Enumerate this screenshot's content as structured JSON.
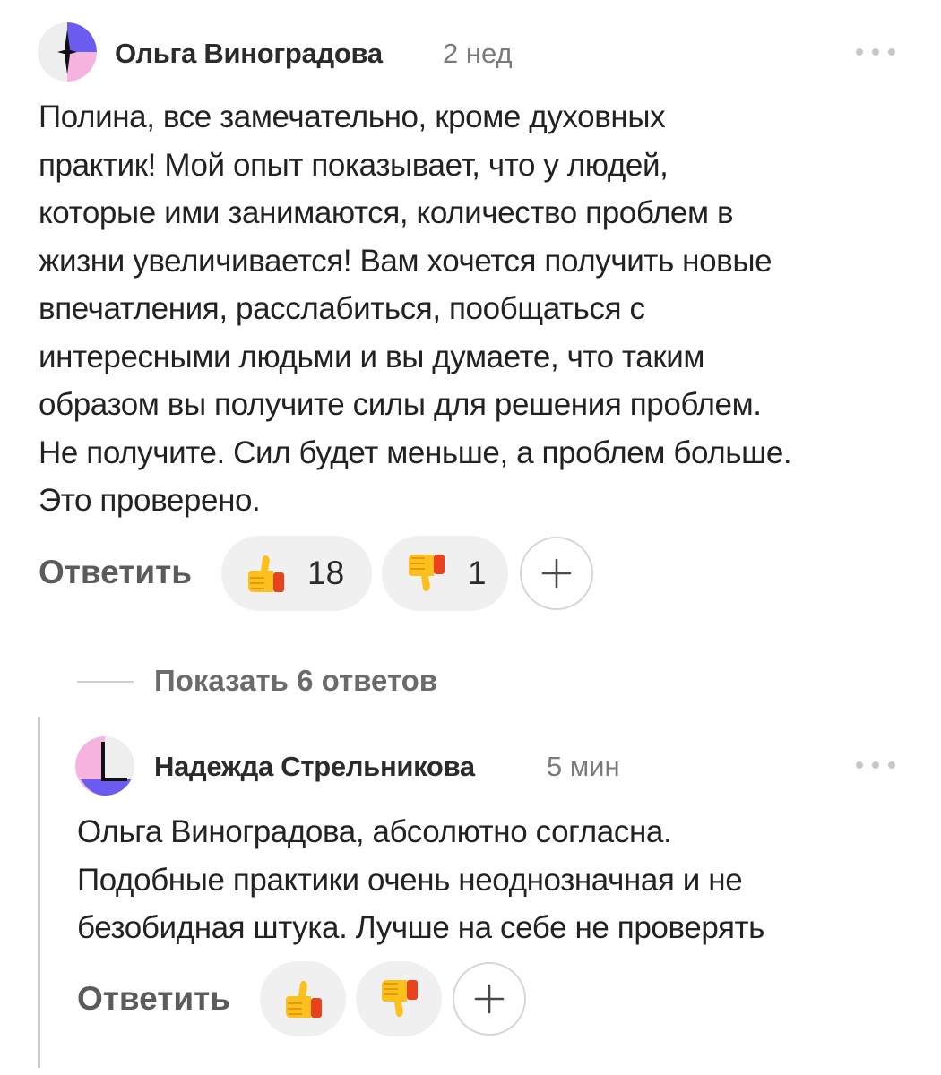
{
  "comment1": {
    "author": "Ольга Виноградова",
    "time": "2 нед",
    "text_lines": [
      "Полина, все замечательно, кроме духовных",
      "практик! Мой опыт показывает, что у людей,",
      "которые ими занимаются, количество проблем в",
      "жизни увеличивается! Вам хочется получить новые",
      "впечатления, расслабиться, пообщаться с",
      "интересными людьми и вы думаете, что таким",
      "образом вы получите силы для решения проблем.",
      "Не получите. Сил будет меньше, а проблем больше.",
      "Это проверено."
    ],
    "reply_label": "Ответить",
    "likes": "18",
    "dislikes": "1",
    "more_icon": "more-dots-icon",
    "add_icon": "plus-icon"
  },
  "replies_toggle": {
    "label": "Показать 6 ответов"
  },
  "comment2": {
    "author": "Надежда Стрельникова",
    "time": "5 мин",
    "text_lines": [
      "Ольга Виноградова, абсолютно согласна.",
      "Подобные практики очень неоднозначная и не",
      "безобидная штука. Лучше на себе не проверять"
    ],
    "reply_label": "Ответить",
    "more_icon": "more-dots-icon",
    "add_icon": "plus-icon"
  },
  "colors": {
    "text": "#222222",
    "muted": "#7b7b7b",
    "pill_bg": "#f0f0f0",
    "avatar_purple": "#6b5cf0",
    "avatar_pink": "#f7b3df"
  }
}
